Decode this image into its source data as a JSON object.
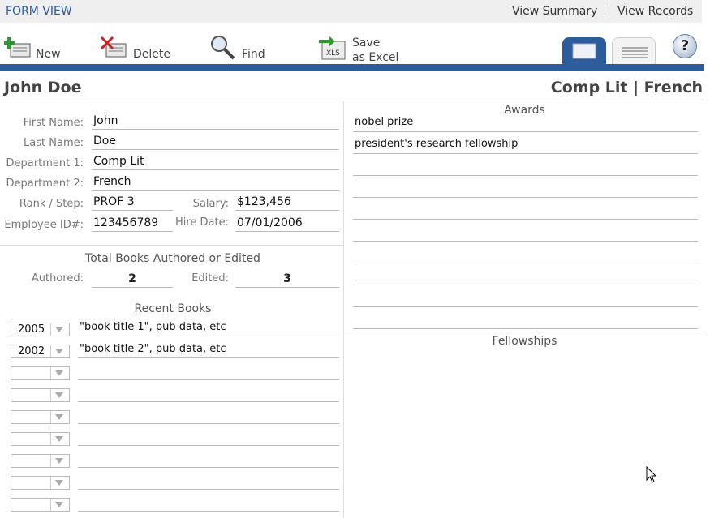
{
  "topbar": {
    "form_view": "FORM VIEW",
    "view_summary": "View Summary",
    "view_records": "View Records"
  },
  "toolbar": {
    "new": "New",
    "delete": "Delete",
    "find": "Find",
    "save_line1": "Save",
    "save_line2": "as Excel",
    "help": "?"
  },
  "header": {
    "name": "John Doe",
    "departments": "Comp Lit | French"
  },
  "fields": {
    "first_name_label": "First Name:",
    "first_name": "John",
    "last_name_label": "Last Name:",
    "last_name": "Doe",
    "dept1_label": "Department 1:",
    "dept1": "Comp Lit",
    "dept2_label": "Department 2:",
    "dept2": "French",
    "rank_label": "Rank / Step:",
    "rank": "PROF 3",
    "salary_label": "Salary:",
    "salary": "$123,456",
    "empid_label": "Employee ID#:",
    "empid": "123456789",
    "hire_label": "Hire Date:",
    "hire": "07/01/2006"
  },
  "books": {
    "heading": "Total Books Authored or Edited",
    "authored_label": "Authored:",
    "authored": "2",
    "edited_label": "Edited:",
    "edited": "3",
    "recent_heading": "Recent Books",
    "recent": [
      {
        "year": "2005",
        "title": "\"book title 1\", pub data, etc"
      },
      {
        "year": "2002",
        "title": "\"book title 2\", pub data, etc"
      },
      {
        "year": "",
        "title": ""
      },
      {
        "year": "",
        "title": ""
      },
      {
        "year": "",
        "title": ""
      },
      {
        "year": "",
        "title": ""
      },
      {
        "year": "",
        "title": ""
      },
      {
        "year": "",
        "title": ""
      },
      {
        "year": "",
        "title": ""
      }
    ]
  },
  "awards": {
    "heading": "Awards",
    "items": [
      "nobel prize",
      "president's research fellowship",
      "",
      "",
      "",
      "",
      "",
      "",
      "",
      ""
    ]
  },
  "fellowships": {
    "heading": "Fellowships"
  },
  "colors": {
    "accent_blue": "#2c5c9c",
    "link_blue": "#2a5aa0"
  }
}
